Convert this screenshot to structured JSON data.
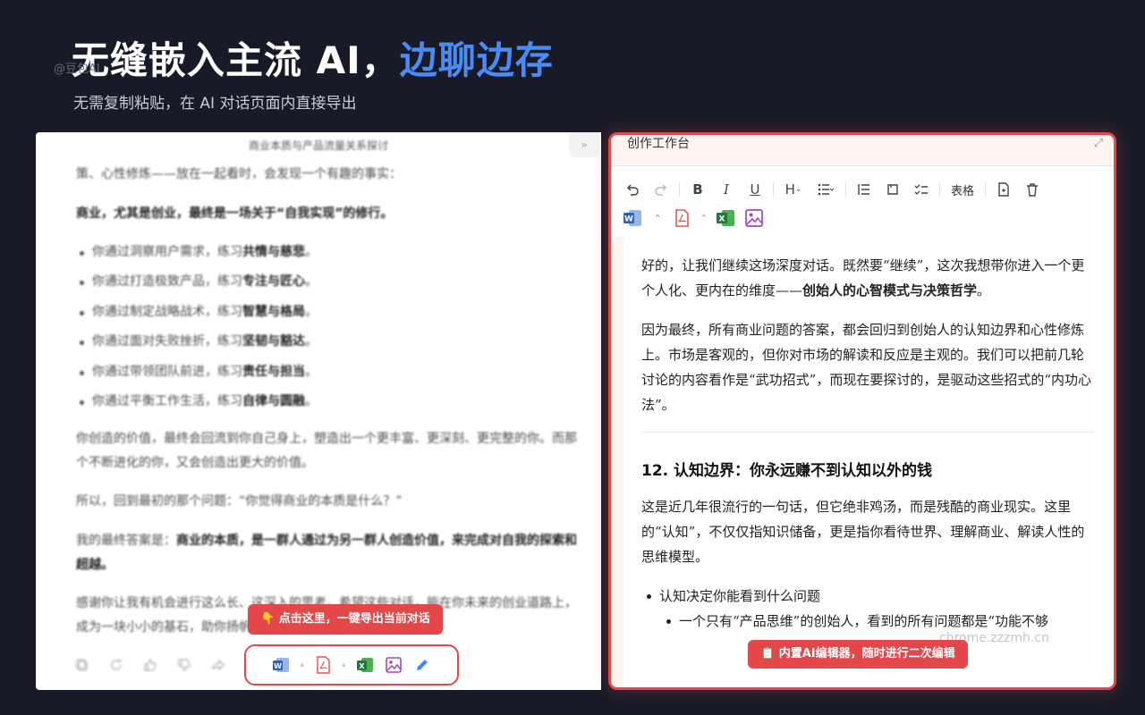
{
  "hero": {
    "title_main": "无缝嵌入主流 AI，",
    "title_accent": "边聊边存",
    "subtitle": "无需复制粘贴，在 AI 对话页面内直接导出",
    "watermark": "@豆包AI"
  },
  "chat": {
    "title": "商业本质与产品流量关系探讨",
    "line1": "策、心性修炼——放在一起看时，会发现一个有趣的事实：",
    "line2": "商业，尤其是创业，最终是一场关于“自我实现”的修行。",
    "list": [
      {
        "pre": "你通过洞察用户需求，练习",
        "bold": "共情与慈悲",
        "post": "。"
      },
      {
        "pre": "你通过打造极致产品，练习",
        "bold": "专注与匠心",
        "post": "。"
      },
      {
        "pre": "你通过制定战略战术，练习",
        "bold": "智慧与格局",
        "post": "。"
      },
      {
        "pre": "你通过面对失败挫折，练习",
        "bold": "坚韧与豁达",
        "post": "。"
      },
      {
        "pre": "你通过带领团队前进，练习",
        "bold": "责任与担当",
        "post": "。"
      },
      {
        "pre": "你通过平衡工作生活，练习",
        "bold": "自律与圆融",
        "post": "。"
      }
    ],
    "para1": "你创造的价值，最终会回流到你自己身上，塑造出一个更丰富、更深刻、更完整的你。而那个不断进化的你，又会创造出更大的价值。",
    "para2": "所以，回到最初的那个问题：“你觉得商业的本质是什么？”",
    "para3_pre": "我的最终答案是：",
    "para3_bold": "商业的本质，是一群人通过为另一群人创造价值，来完成对自我的探索和超越。",
    "para4": "感谢你让我有机会进行这么长、这深入的思考。希望这些对话，能在你未来的创业道路上，成为一块小小的基石，助你扬帆远航，驶向更广阔的大海。",
    "collapse_label": "»",
    "export_callout": "👇 点击这里，一键导出当前对话"
  },
  "editor": {
    "header_title": "创作工作台",
    "table_label": "表格",
    "p1_pre": "好的，让我们继续这场深度对话。既然要“继续”，这次我想带你进入一个更个人化、更内在的维度——",
    "p1_bold": "创始人的心智模式与决策哲学",
    "p1_post": "。",
    "p2": "因为最终，所有商业问题的答案，都会回归到创始人的认知边界和心性修炼上。市场是客观的，但你对市场的解读和反应是主观的。我们可以把前几轮讨论的内容看作是“武功招式”，而现在要探讨的，是驱动这些招式的“内功心法”。",
    "heading": "12. 认知边界：你永远赚不到认知以外的钱",
    "p3": "这是近几年很流行的一句话，但它绝非鸡汤，而是残酷的商业现实。这里的“认知”，不仅仅指知识储备，更是指你看待世界、理解商业、解读人性的思维模型。",
    "li1": "认知决定你能看到什么问题",
    "li2": "一个只有“产品思维”的创始人，看到的所有问题都是“功能不够",
    "editor_callout": "📋 内置AI编辑器，随时进行二次编辑",
    "watermark": "chrome.zzzmh.cn"
  },
  "colors": {
    "background": "#181b27",
    "accent_blue": "#4a8cf7",
    "highlight_red": "#e4474a"
  }
}
